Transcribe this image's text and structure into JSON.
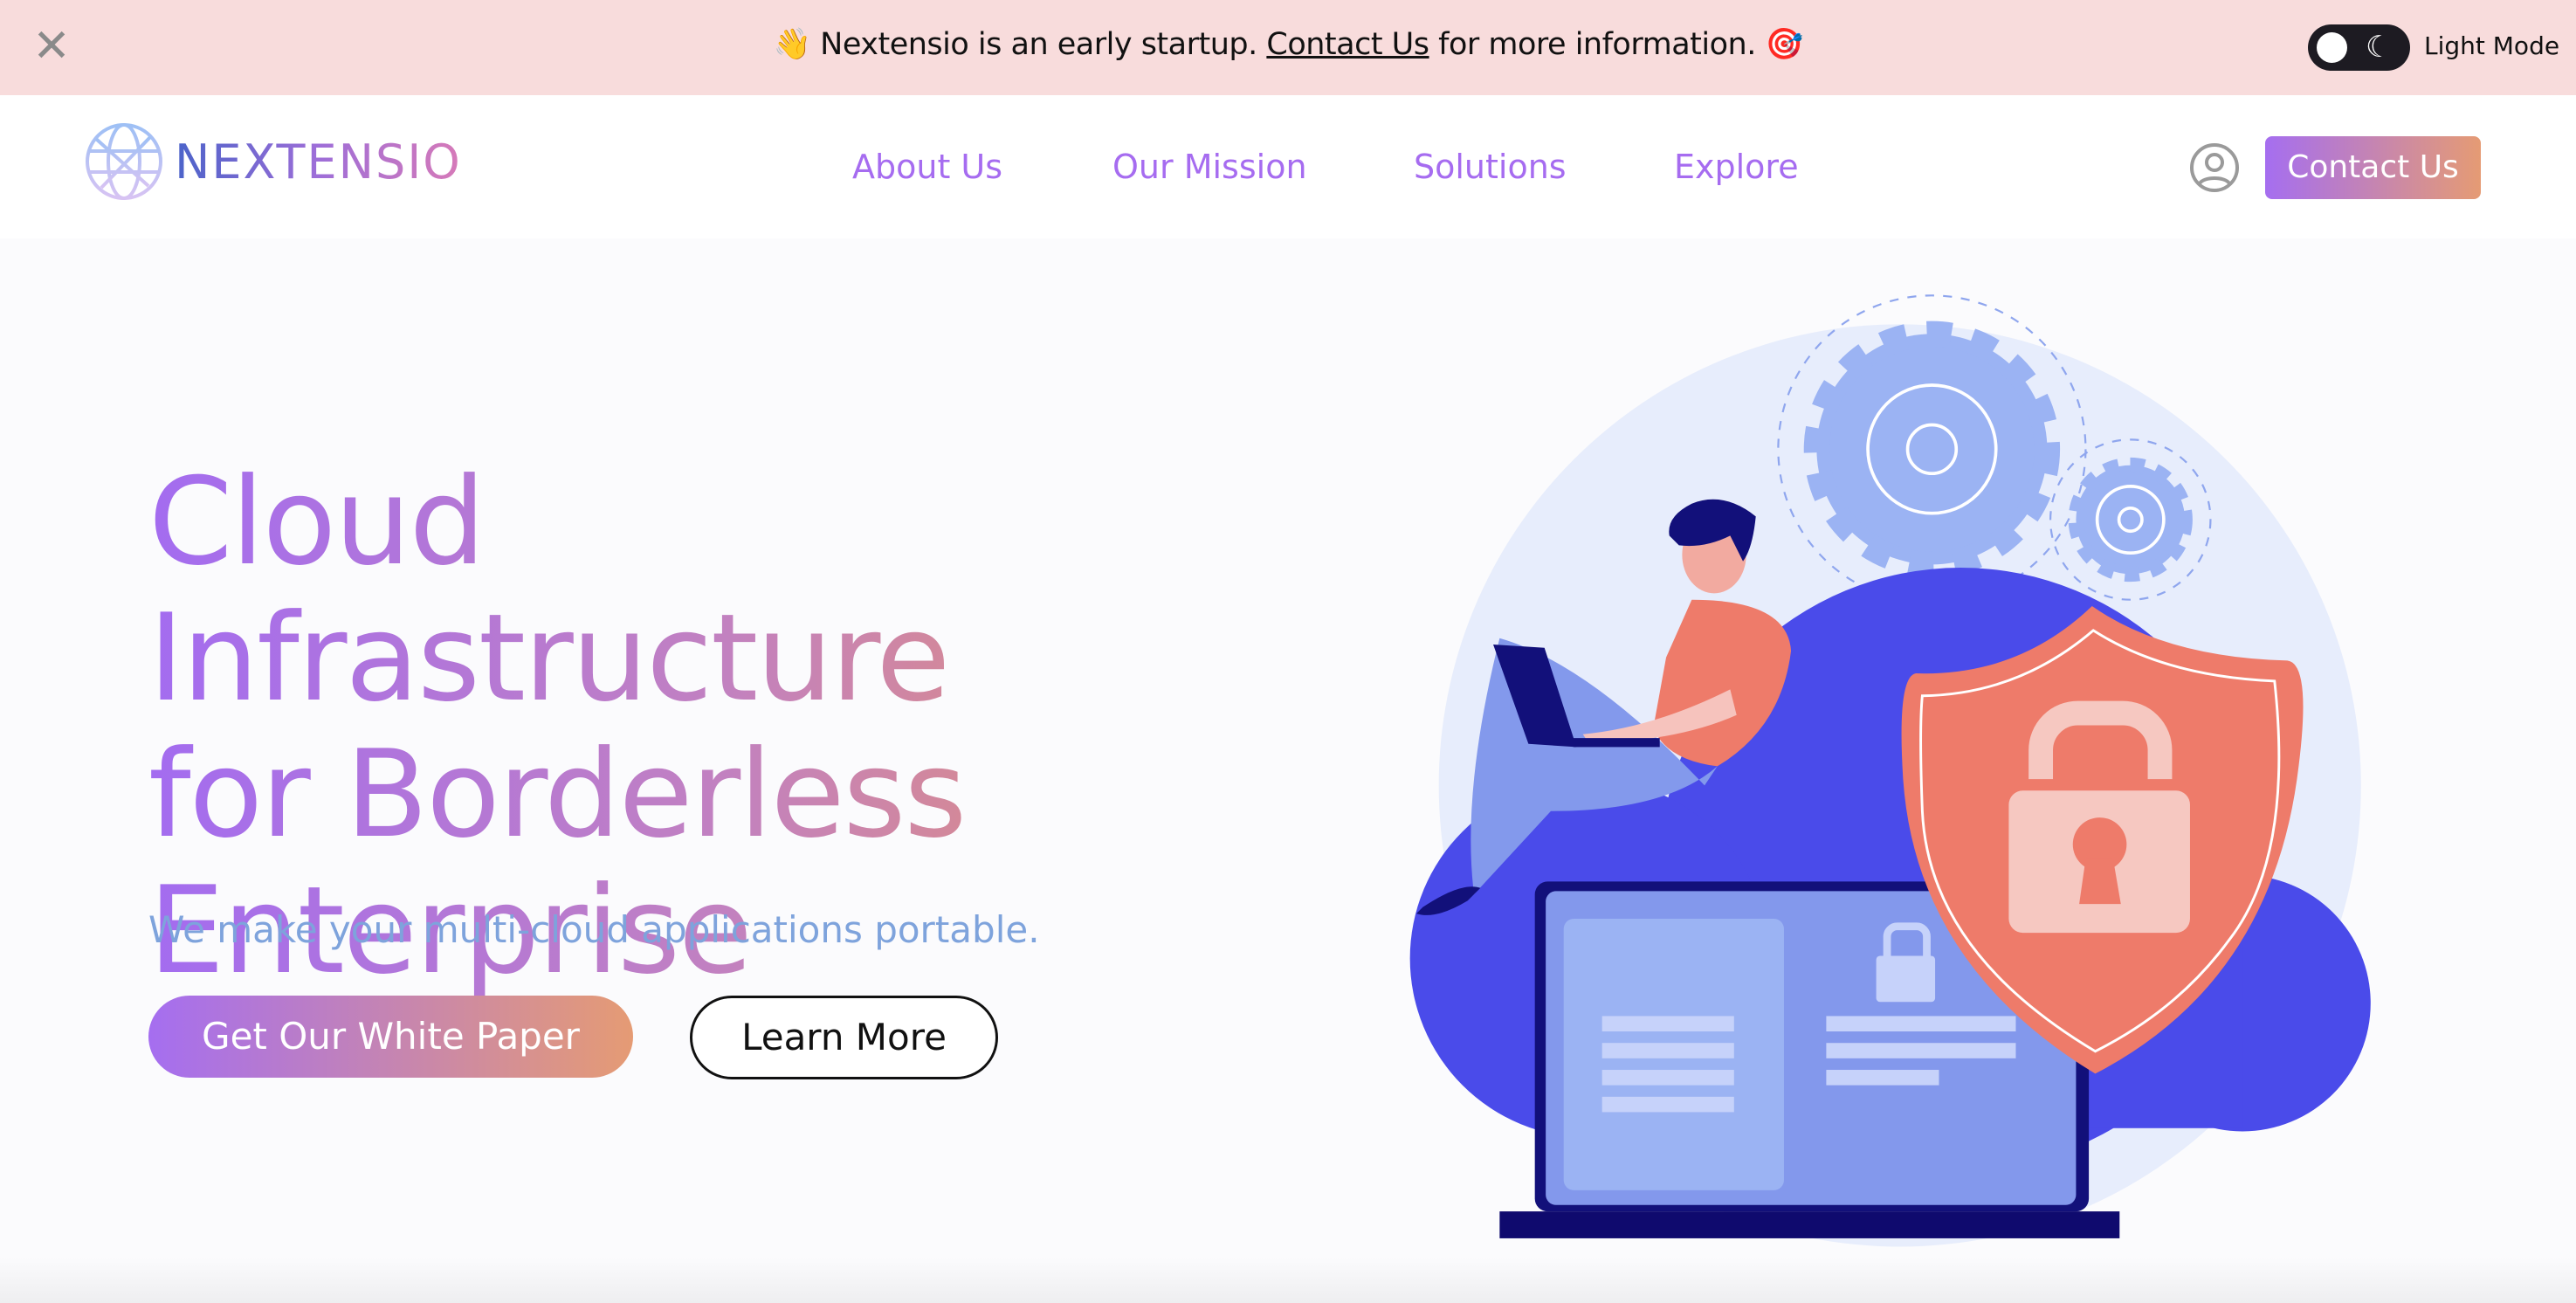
{
  "banner": {
    "close_icon": "close-icon",
    "emoji_start": "👋",
    "text_before": " Nextensio is an early startup. ",
    "link": "Contact Us",
    "text_after": " for more information. ",
    "emoji_end": "🎯",
    "mode_label": "Light Mode"
  },
  "nav": {
    "brand": "NEXTENSIO",
    "items": [
      "About Us",
      "Our Mission",
      "Solutions",
      "Explore"
    ],
    "contact": "Contact Us"
  },
  "hero": {
    "title_lines": [
      "Cloud Infrastructure",
      "for Borderless",
      "Enterprise"
    ],
    "subtitle": "We make your multi-cloud applications portable.",
    "primary": "Get Our White Paper",
    "secondary": "Learn More"
  },
  "colors": {
    "accent": "#a66cf0",
    "accent_end": "#e59b74",
    "banner": "#f8dcdc"
  }
}
